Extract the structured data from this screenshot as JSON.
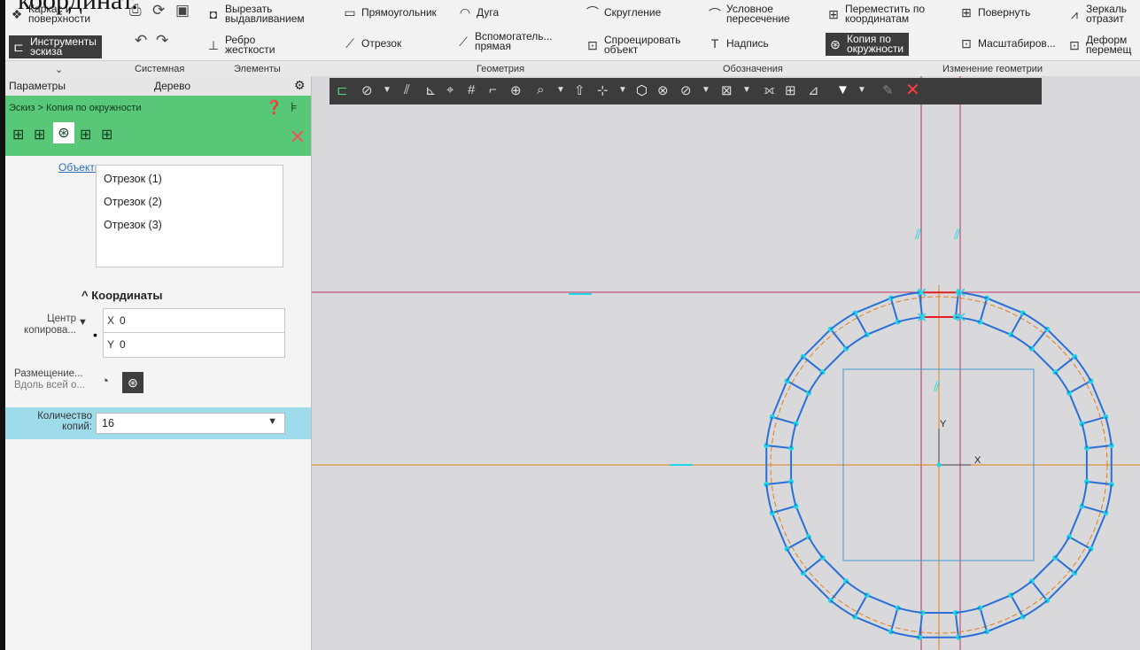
{
  "top_caption": "координат.",
  "ribbon": {
    "items": [
      {
        "icon": "frame-surface-icon",
        "glyph": "❖",
        "lines": [
          "Каркас и",
          "поверхности"
        ]
      },
      {
        "icon": "sketch-tools-icon",
        "glyph": "⊏",
        "lines": [
          "Инструменты",
          "эскиза"
        ],
        "dark": true
      },
      {
        "icon": "cut-extrude-icon",
        "glyph": "◘",
        "lines": [
          "Вырезать",
          "выдавливанием"
        ]
      },
      {
        "icon": "rib-icon",
        "glyph": "⊥",
        "lines": [
          "Ребро",
          "жесткости"
        ]
      },
      {
        "icon": "rectangle-icon",
        "glyph": "▭",
        "lines": [
          "Прямоугольник"
        ]
      },
      {
        "icon": "arc-icon",
        "glyph": "◠",
        "lines": [
          "Дуга"
        ]
      },
      {
        "icon": "segment-icon",
        "glyph": "⟋",
        "lines": [
          "Отрезок"
        ]
      },
      {
        "icon": "aux-line-icon",
        "glyph": "⟋",
        "lines": [
          "Вспомогатель...",
          "прямая"
        ]
      },
      {
        "icon": "fillet-icon",
        "glyph": "⌒",
        "lines": [
          "Скругление"
        ]
      },
      {
        "icon": "project-object-icon",
        "glyph": "⊡",
        "lines": [
          "Спроецировать",
          "объект"
        ]
      },
      {
        "icon": "conditional-intersection-icon",
        "glyph": "⌒",
        "lines": [
          "Условное",
          "пересечение"
        ]
      },
      {
        "icon": "text-icon",
        "glyph": "T",
        "lines": [
          "Надпись"
        ]
      },
      {
        "icon": "move-by-coords-icon",
        "glyph": "⊞",
        "lines": [
          "Переместить по",
          "координатам"
        ]
      },
      {
        "icon": "circular-copy-icon",
        "glyph": "⊛",
        "lines": [
          "Копия по",
          "окружности"
        ],
        "dark": true
      },
      {
        "icon": "rotate-icon",
        "glyph": "⊞",
        "lines": [
          "Повернуть"
        ]
      },
      {
        "icon": "scale-icon",
        "glyph": "⊡",
        "lines": [
          "Масштабиров..."
        ]
      },
      {
        "icon": "mirror-icon",
        "glyph": "⩘",
        "lines": [
          "Зеркаль",
          "отразит"
        ]
      },
      {
        "icon": "deform-icon",
        "glyph": "⊡",
        "lines": [
          "Деформ",
          "перемещ"
        ]
      }
    ],
    "groups": [
      "Системная",
      "Элементы",
      "Геометрия",
      "Обозначения",
      "Изменение геометрии"
    ]
  },
  "panel": {
    "tabs": [
      "Параметры",
      "Дерево"
    ],
    "breadcrumb": "Эскиз > Копия по окружности",
    "objects_label": "Объекты",
    "objects": [
      "Отрезок (1)",
      "Отрезок (2)",
      "Отрезок (3)"
    ],
    "coords_header": "Координаты",
    "center_label": "Центр копирова...",
    "x_axis": "X",
    "x_value": "0",
    "y_axis": "Y",
    "y_value": "0",
    "placement_label": "Размещение...",
    "placement_value": "Вдоль всей о...",
    "count_label": "Количество копий:",
    "count_value": "16"
  },
  "canvas": {
    "axis_x_label": "X",
    "axis_y_label": "Y",
    "copy_count": 16,
    "colors": {
      "background": "#d9d9db",
      "construction_line": "#c0306a",
      "centerline": "#e0801a",
      "geometry": "#2a6fd6",
      "point": "#1fd6e6",
      "selection": "#e02020",
      "accent_dark": "#3c3c3c"
    }
  }
}
